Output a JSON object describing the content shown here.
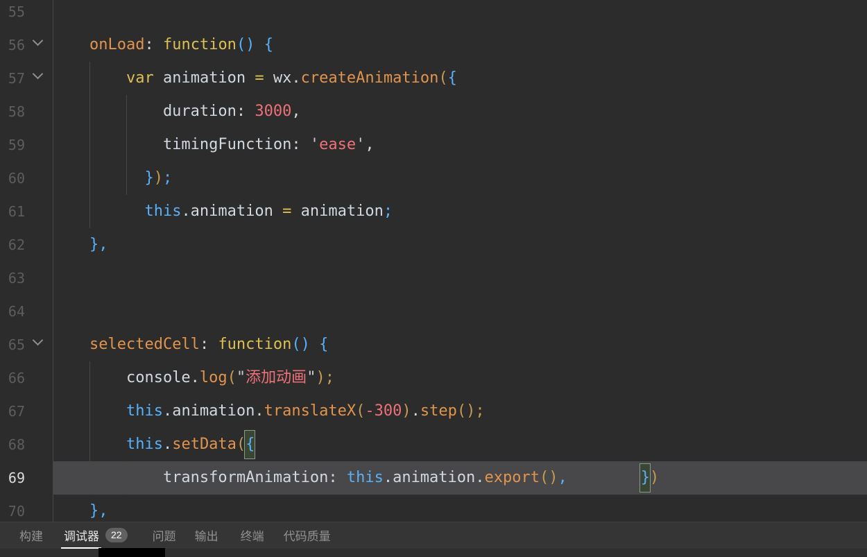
{
  "colors": {
    "background": "#2c2c2c",
    "line_highlight": "#48484b",
    "text": "#d2d8df",
    "orange": "#e2944d",
    "yellow": "#ddc04f",
    "blue": "#5ab0f6",
    "gold": "#c79b51",
    "salmon": "#ee7178",
    "quote": "#c9cdd1",
    "gutter_number": "#5d5d5d",
    "gutter_number_active": "#dcdcdc",
    "indent_guide": "#474747",
    "bracket_match_border": "#8a9a88",
    "bracket_match_bg": "#3a4534",
    "panel_bg": "#353536",
    "tab_inactive": "#919191",
    "tab_active": "#e8e8e8",
    "badge_bg": "#616161",
    "active_tab_underline": "#ffffff"
  },
  "editor": {
    "lines": [
      {
        "num": 55,
        "chevron": false,
        "active": false,
        "tokens": []
      },
      {
        "num": 56,
        "chevron": true,
        "active": false,
        "tokens": [
          {
            "t": "    "
          },
          {
            "t": "onLoad",
            "c": "orange"
          },
          {
            "t": ": "
          },
          {
            "t": "function",
            "c": "yellow"
          },
          {
            "t": "()",
            "c": "blue"
          },
          {
            "t": " "
          },
          {
            "t": "{",
            "c": "blue"
          }
        ]
      },
      {
        "num": 57,
        "chevron": true,
        "active": false,
        "tokens": [
          {
            "t": "        "
          },
          {
            "t": "var",
            "c": "yellow"
          },
          {
            "t": " animation "
          },
          {
            "t": "=",
            "c": "yellow"
          },
          {
            "t": " wx."
          },
          {
            "t": "createAnimation",
            "c": "orange"
          },
          {
            "t": "(",
            "c": "gold"
          },
          {
            "t": "{",
            "c": "blue"
          }
        ]
      },
      {
        "num": 58,
        "chevron": false,
        "active": false,
        "tokens": [
          {
            "t": "            duration: "
          },
          {
            "t": "3000",
            "c": "salmon"
          },
          {
            "t": ","
          }
        ]
      },
      {
        "num": 59,
        "chevron": false,
        "active": false,
        "tokens": [
          {
            "t": "            timingFunction: "
          },
          {
            "t": "'",
            "c": "quote"
          },
          {
            "t": "ease",
            "c": "salmon"
          },
          {
            "t": "'",
            "c": "quote"
          },
          {
            "t": ","
          }
        ]
      },
      {
        "num": 60,
        "chevron": false,
        "active": false,
        "tokens": [
          {
            "t": "          "
          },
          {
            "t": "}",
            "c": "blue"
          },
          {
            "t": ")",
            "c": "gold"
          },
          {
            "t": ";",
            "c": "blue"
          }
        ]
      },
      {
        "num": 61,
        "chevron": false,
        "active": false,
        "tokens": [
          {
            "t": "          "
          },
          {
            "t": "this",
            "c": "blue"
          },
          {
            "t": ".animation "
          },
          {
            "t": "=",
            "c": "yellow"
          },
          {
            "t": " animation"
          },
          {
            "t": ";",
            "c": "blue"
          }
        ]
      },
      {
        "num": 62,
        "chevron": false,
        "active": false,
        "tokens": [
          {
            "t": "    "
          },
          {
            "t": "},",
            "c": "blue"
          }
        ]
      },
      {
        "num": 63,
        "chevron": false,
        "active": false,
        "tokens": []
      },
      {
        "num": 64,
        "chevron": false,
        "active": false,
        "tokens": []
      },
      {
        "num": 65,
        "chevron": true,
        "active": false,
        "tokens": [
          {
            "t": "    "
          },
          {
            "t": "selectedCell",
            "c": "orange"
          },
          {
            "t": ": "
          },
          {
            "t": "function",
            "c": "yellow"
          },
          {
            "t": "()",
            "c": "blue"
          },
          {
            "t": " "
          },
          {
            "t": "{",
            "c": "blue"
          }
        ]
      },
      {
        "num": 66,
        "chevron": false,
        "active": false,
        "tokens": [
          {
            "t": "        console."
          },
          {
            "t": "log",
            "c": "orange"
          },
          {
            "t": "(",
            "c": "gold"
          },
          {
            "t": "\"",
            "c": "quote"
          },
          {
            "t": "添加动画",
            "c": "salmon"
          },
          {
            "t": "\"",
            "c": "quote"
          },
          {
            "t": ")",
            "c": "gold"
          },
          {
            "t": ";",
            "c": "gold"
          }
        ]
      },
      {
        "num": 67,
        "chevron": false,
        "active": false,
        "tokens": [
          {
            "t": "        "
          },
          {
            "t": "this",
            "c": "blue"
          },
          {
            "t": ".animation."
          },
          {
            "t": "translateX",
            "c": "orange"
          },
          {
            "t": "(",
            "c": "gold"
          },
          {
            "t": "-300",
            "c": "salmon"
          },
          {
            "t": ")",
            "c": "gold"
          },
          {
            "t": "."
          },
          {
            "t": "step",
            "c": "orange"
          },
          {
            "t": "()",
            "c": "gold"
          },
          {
            "t": ";",
            "c": "gold"
          }
        ]
      },
      {
        "num": 68,
        "chevron": false,
        "active": false,
        "tokens": [
          {
            "t": "        "
          },
          {
            "t": "this",
            "c": "blue"
          },
          {
            "t": "."
          },
          {
            "t": "setData",
            "c": "orange"
          },
          {
            "t": "(",
            "c": "gold"
          },
          {
            "t": "{",
            "c": "blue",
            "m": true
          }
        ]
      },
      {
        "num": 69,
        "chevron": false,
        "active": true,
        "tokens": [
          {
            "t": "            transformAnimation: "
          },
          {
            "t": "this",
            "c": "blue"
          },
          {
            "t": ".animation."
          },
          {
            "t": "export",
            "c": "orange"
          },
          {
            "t": "()",
            "c": "gold"
          },
          {
            "t": ",",
            "c": "blue"
          },
          {
            "t": "        "
          },
          {
            "t": "}",
            "c": "blue",
            "m": true
          },
          {
            "t": ")",
            "c": "gold"
          }
        ]
      },
      {
        "num": 70,
        "chevron": false,
        "active": false,
        "tokens": [
          {
            "t": "    "
          },
          {
            "t": "},",
            "c": "blue"
          }
        ]
      }
    ],
    "indent_guides": [
      {
        "col": 0,
        "from": 55,
        "to": 70
      },
      {
        "col": 4,
        "from": 57,
        "to": 61
      },
      {
        "col": 4,
        "from": 66,
        "to": 69
      },
      {
        "col": 8,
        "from": 58,
        "to": 60
      },
      {
        "col": 8,
        "from": 69,
        "to": 69
      }
    ]
  },
  "panel": {
    "tabs": [
      {
        "label": "构建",
        "active": false
      },
      {
        "label": "调试器",
        "active": true,
        "badge": "22"
      },
      {
        "label": "问题",
        "active": false
      },
      {
        "label": "输出",
        "active": false
      },
      {
        "label": "终端",
        "active": false
      },
      {
        "label": "代码质量",
        "active": false
      }
    ]
  }
}
